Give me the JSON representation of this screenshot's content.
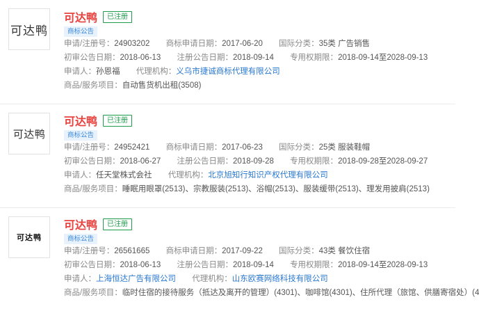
{
  "labels": {
    "reg_no": "申请/注册号：",
    "apply_date": "商标申请日期：",
    "intl_class": "国际分类：",
    "pre_announce": "初审公告日期：",
    "reg_announce": "注册公告日期：",
    "exclusive_period": "专用权期限：",
    "applicant": "申请人：",
    "agency": "代理机构：",
    "goods": "商品/服务项目："
  },
  "records": [
    {
      "logo_text": "可达鸭",
      "name": "可达鸭",
      "status": "已注册",
      "tag": "商标公告",
      "reg_no": "24903202",
      "apply_date": "2017-06-20",
      "intl_class": "35类 广告销售",
      "pre_announce": "2018-06-13",
      "reg_announce": "2018-09-14",
      "exclusive_period": "2018-09-14至2028-09-13",
      "applicant": "孙恩福",
      "agency": "义乌市捷诚商标代理有限公司",
      "goods": "自动售货机出租(3508)"
    },
    {
      "logo_text": "可达鸭",
      "name": "可达鸭",
      "status": "已注册",
      "tag": "商标公告",
      "reg_no": "24952421",
      "apply_date": "2017-06-23",
      "intl_class": "25类 服装鞋帽",
      "pre_announce": "2018-06-27",
      "reg_announce": "2018-09-28",
      "exclusive_period": "2018-09-28至2028-09-27",
      "applicant": "任天堂株式会社",
      "agency": "北京旭知行知识产权代理有限公司",
      "goods": "睡眠用眼罩(2513)、宗教服装(2513)、浴帽(2513)、服装缓带(2513)、理发用披肩(2513)"
    },
    {
      "logo_text": "可达鸭",
      "name": "可达鸭",
      "status": "已注册",
      "tag": "商标公告",
      "reg_no": "26561665",
      "apply_date": "2017-09-22",
      "intl_class": "43类 餐饮住宿",
      "pre_announce": "2018-06-13",
      "reg_announce": "2018-09-14",
      "exclusive_period": "2018-09-14至2028-09-13",
      "applicant": "上海恒达广告有限公司",
      "agency": "山东欧赛网络科技有限公司",
      "goods": "临时住宿的接待服务（抵达及离开的管理）(4301)、咖啡馆(4301)、住所代理（旅馆、供膳寄宿处）(4"
    }
  ]
}
